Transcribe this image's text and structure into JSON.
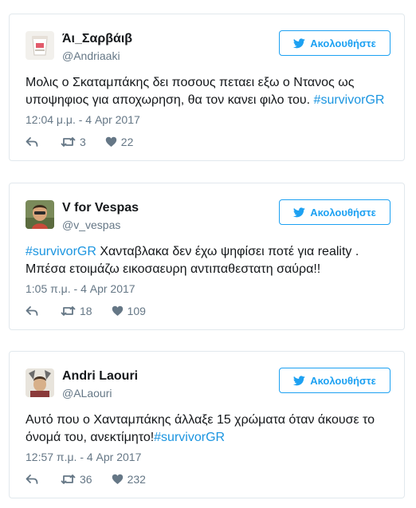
{
  "follow_label": "Ακολουθήστε",
  "colors": {
    "accent": "#1da1f2",
    "hashtag": "#1b95e0",
    "muted": "#657786",
    "text": "#14171a",
    "border": "#e1e8ed"
  },
  "tweets": [
    {
      "name": "Άι_Σαρβάιβ",
      "handle": "@Andriaaki",
      "text_line1": "Μολις ο Σκαταμπάκης δει ποσους πεταει εξω ο Ντανος ως",
      "text_line2_plain": "υποψηφιος για αποχωρηση, θα τον κανει φιλο του. ",
      "hashtag": "#survivorGR",
      "time": "12:04 μ.μ. - 4 Apr 2017",
      "retweets": "3",
      "likes": "22"
    },
    {
      "name": "V for Vespas",
      "handle": "@v_vespas",
      "hashtag": "#survivorGR",
      "text_line1_plain": " Χανταβλακα δεν έχω ψηφίσει ποτέ για reality .",
      "text_line2": "Μπέσα ετοιμάζω εικοσαευρη αντιπαθεστατη σαύρα!!",
      "time": "1:05 π.μ. - 4 Apr 2017",
      "retweets": "18",
      "likes": "109"
    },
    {
      "name": "Andri Laouri",
      "handle": "@ALaouri",
      "text_line1": "Αυτό που ο Χανταμπάκης άλλαξε 15 χρώματα όταν άκουσε το",
      "text_line2_plain": "όνομά του, ανεκτίμητο!",
      "hashtag": "#survivorGR",
      "time": "12:57 π.μ. - 4 Apr 2017",
      "retweets": "36",
      "likes": "232"
    }
  ]
}
